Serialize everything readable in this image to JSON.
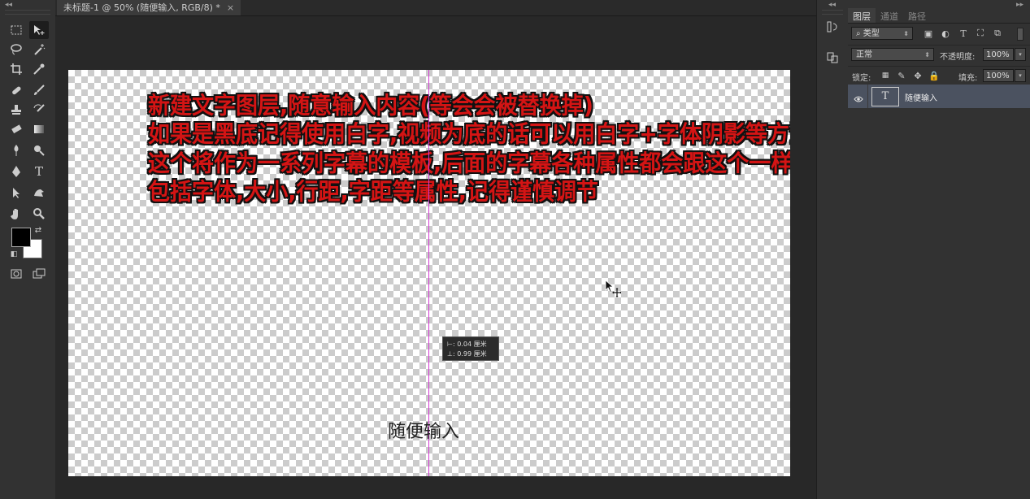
{
  "document": {
    "tab_title": "未标题-1 @ 50% (随便输入, RGB/8) *",
    "close_glyph": "×"
  },
  "canvas": {
    "overlay_lines": [
      "新建文字图层,随意输入内容(等会会被替换掉)",
      "如果是黑底记得使用白字,视频为底的话可以用白字+字体阴影等方法",
      "这个将作为一系列字幕的模板,后面的字幕各种属性都会跟这个一样,",
      "包括字体,大小,行距,字距等属性,记得谨慎调节"
    ],
    "placeholder_text": "随便输入",
    "measure_tooltip": {
      "x_label": "⊢:",
      "x_value": "0.04 厘米",
      "y_label": "⊥:",
      "y_value": "0.99 厘米"
    }
  },
  "layers_panel": {
    "tabs": [
      "图层",
      "通道",
      "路径"
    ],
    "active_tab": "图层",
    "filter_select": "类型",
    "blend_mode": "正常",
    "opacity_label": "不透明度:",
    "opacity_value": "100%",
    "lock_label": "锁定:",
    "fill_label": "填充:",
    "fill_value": "100%",
    "layers": [
      {
        "name": "随便输入",
        "type_glyph": "T",
        "visible": true
      }
    ]
  },
  "colors": {
    "foreground": "#000000",
    "background": "#ffffff",
    "guide": "#d23bd2",
    "overlay_text": "#d41414",
    "selected_layer": "#4b5260"
  }
}
